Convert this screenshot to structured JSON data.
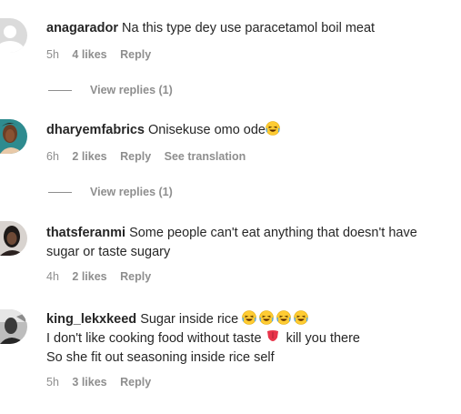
{
  "comments": [
    {
      "username": "anagarador",
      "text": "Na this type dey use paracetamol boil meat",
      "time": "5h",
      "likes": "4 likes",
      "reply": "Reply",
      "view_replies": "View replies (1)",
      "avatar": "default-avatar-icon"
    },
    {
      "username": "dharyemfabrics",
      "text": "Onisekuse omo ode",
      "time": "6h",
      "likes": "2 likes",
      "reply": "Reply",
      "see_translation": "See translation",
      "view_replies": "View replies (1)",
      "avatar": "profile-photo"
    },
    {
      "username": "thatsferanmi",
      "text": "Some people can't eat anything that doesn't have sugar or taste sugary",
      "time": "4h",
      "likes": "2 likes",
      "reply": "Reply",
      "avatar": "profile-photo"
    },
    {
      "username": "king_lekxkeed",
      "text_line1": "Sugar inside rice",
      "text_line2a": "I don't like cooking food without taste",
      "text_line2b": "kill you there",
      "text_line3": "So she fit out seasoning inside rice self",
      "time": "5h",
      "likes": "3 likes",
      "reply": "Reply",
      "avatar": "profile-photo"
    }
  ],
  "colors": {
    "text": "#262626",
    "muted": "#8e8e8e",
    "emoji_face": "#ffcc33"
  }
}
